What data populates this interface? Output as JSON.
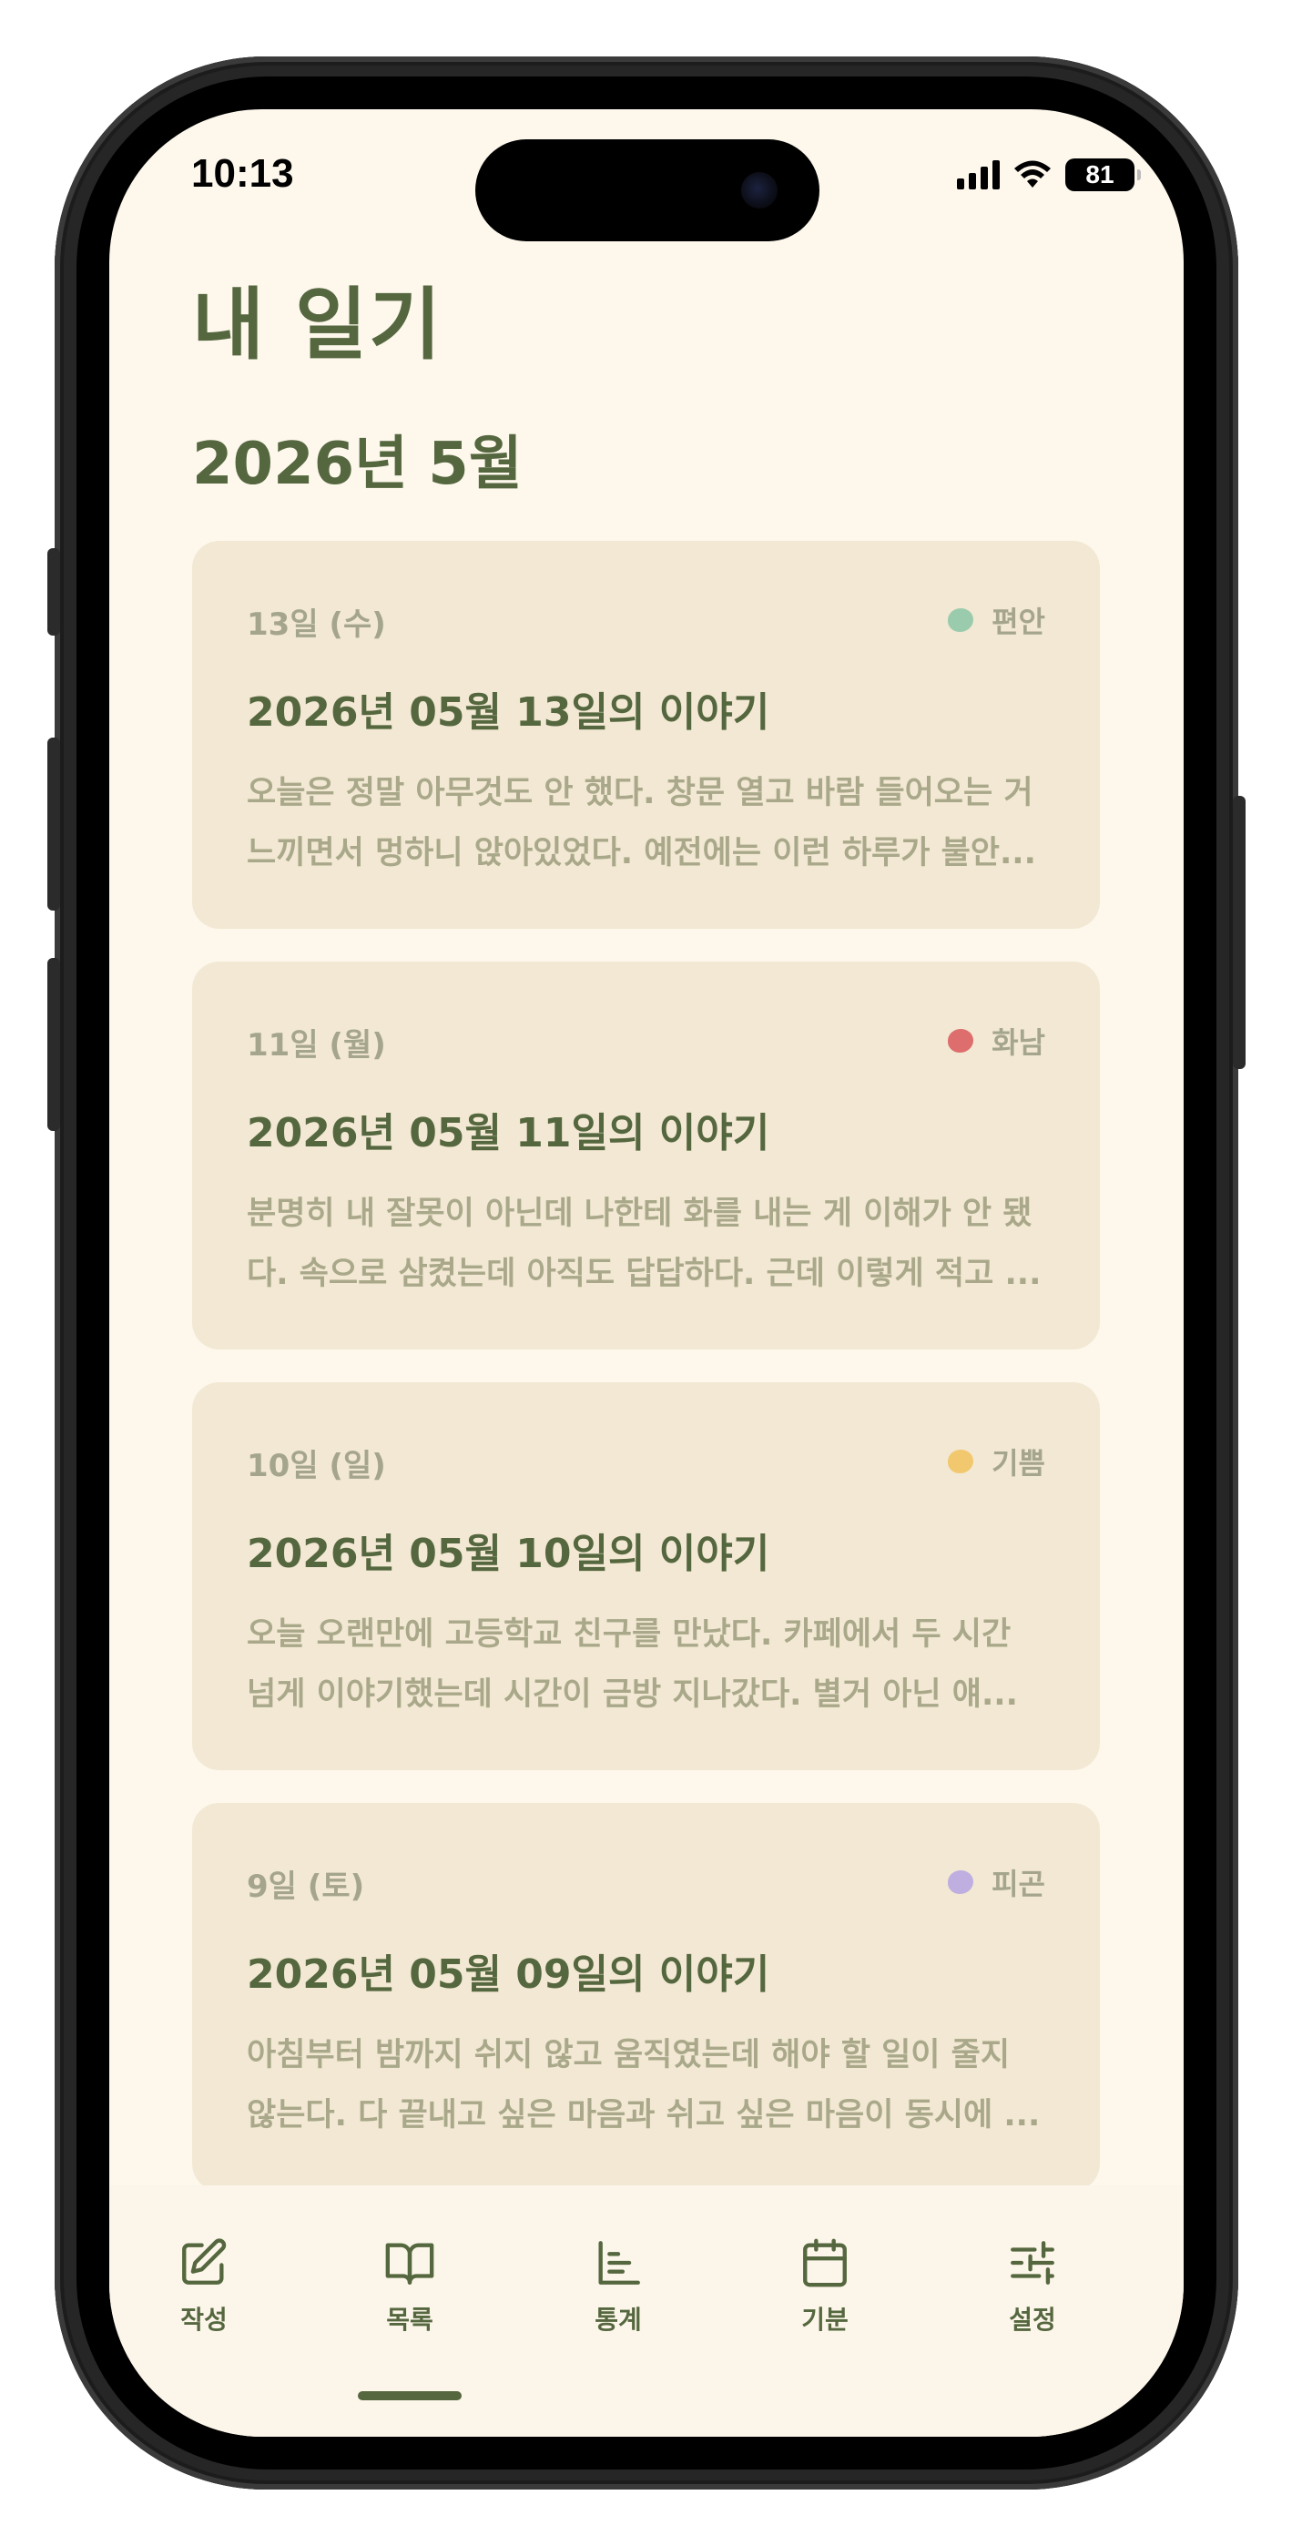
{
  "status": {
    "time": "10:13",
    "battery": "81"
  },
  "app": {
    "title": "내 일기"
  },
  "list": {
    "month_header": "2026년 5월"
  },
  "entries": [
    {
      "date": "13일 (수)",
      "mood": "편안",
      "mood_color": "#8cc5a6",
      "title": "2026년 05월 13일의 이야기",
      "preview": "오늘은 정말 아무것도 안 했다. 창문 열고 바람 들어오는 거 느끼면서 멍하니 앉아있었다. 예전에는 이런 하루가 불안..."
    },
    {
      "date": "11일 (월)",
      "mood": "화남",
      "mood_color": "#d9585b",
      "title": "2026년 05월 11일의 이야기",
      "preview": "분명히 내 잘못이 아닌데 나한테 화를 내는 게 이해가 안 됐다. 속으로 삼켰는데 아직도 답답하다. 근데 이렇게 적고 ..."
    },
    {
      "date": "10일 (일)",
      "mood": "기쁨",
      "mood_color": "#f1c25c",
      "title": "2026년 05월 10일의 이야기",
      "preview": "오늘 오랜만에 고등학교 친구를 만났다. 카페에서 두 시간 넘게 이야기했는데 시간이 금방 지나갔다. 별거 아닌 얘..."
    },
    {
      "date": "9일 (토)",
      "mood": "피곤",
      "mood_color": "#b6a5e3",
      "title": "2026년 05월 09일의 이야기",
      "preview": "아침부터 밤까지 쉬지 않고 움직였는데 해야 할 일이 줄지 않는다. 다 끝내고 싶은 마음과 쉬고 싶은 마음이 동시에 ..."
    }
  ],
  "tabs": [
    {
      "label": "작성",
      "icon": "pencil-square-icon"
    },
    {
      "label": "목록",
      "icon": "open-book-icon",
      "active": true
    },
    {
      "label": "통계",
      "icon": "bar-chart-icon"
    },
    {
      "label": "기분",
      "icon": "calendar-icon"
    },
    {
      "label": "설정",
      "icon": "sliders-icon"
    }
  ],
  "colors": {
    "accent": "#55673f",
    "background": "#fdf7ec",
    "card": "#f2e8d3",
    "muted_text": "#a9a88a"
  }
}
